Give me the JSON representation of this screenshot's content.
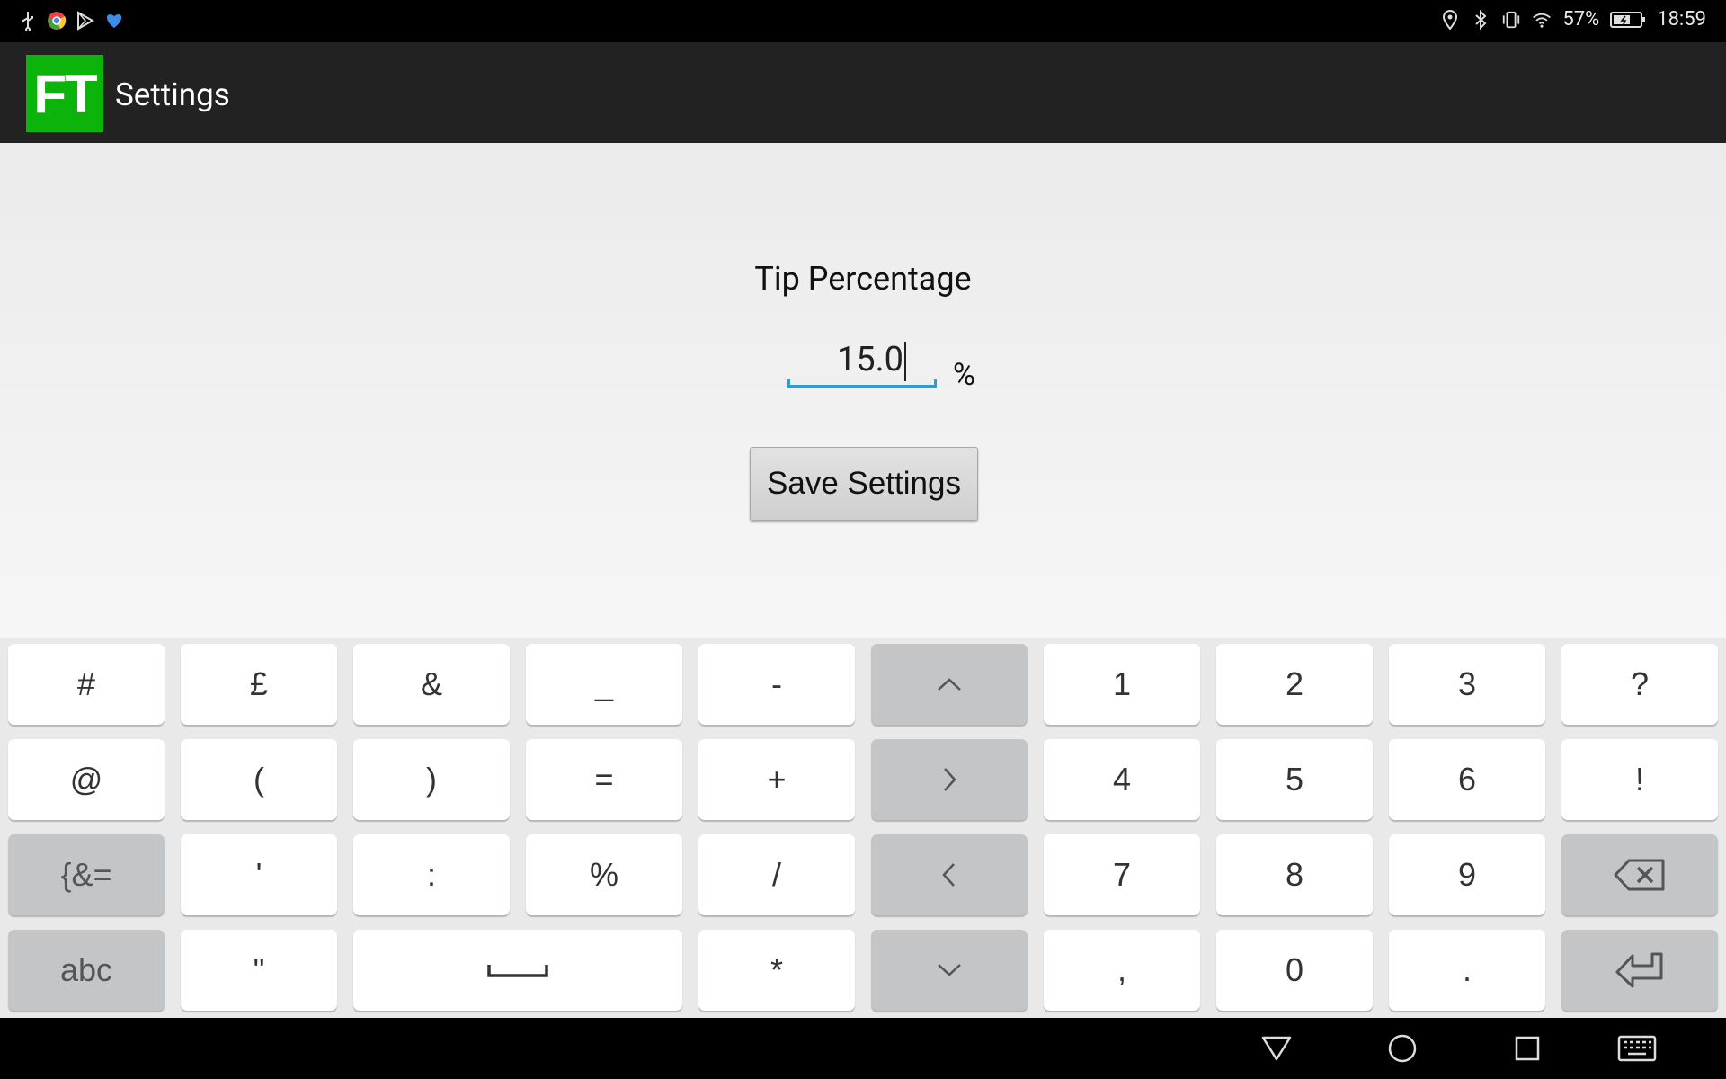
{
  "status_bar": {
    "battery_percent": "57%",
    "time": "18:59",
    "left_icons": [
      "usb-icon",
      "chrome-icon",
      "play-store-icon",
      "app-notification-icon"
    ],
    "right_icons": [
      "location-icon",
      "bluetooth-icon",
      "vibrate-icon",
      "wifi-icon",
      "battery-icon"
    ]
  },
  "app_bar": {
    "logo_text": "FT",
    "logo_color": "#0bb30b",
    "title": "Settings"
  },
  "settings": {
    "tip_label": "Tip Percentage",
    "tip_value": "15.0",
    "percent_sign": "%",
    "save_button": "Save Settings",
    "accent_color": "#2a9fd6"
  },
  "keyboard": {
    "rows": [
      [
        "#",
        "£",
        "&",
        "_",
        "-",
        "shift-up-icon",
        "1",
        "2",
        "3",
        "?"
      ],
      [
        "@",
        "(",
        ")",
        "=",
        "+",
        "cursor-right-icon",
        "4",
        "5",
        "6",
        "!"
      ],
      [
        "{&=",
        "'",
        ":",
        "%",
        "/",
        "cursor-left-icon",
        "7",
        "8",
        "9",
        "backspace-icon"
      ],
      [
        "abc",
        "\"",
        "space-icon",
        "*",
        "cursor-down-icon",
        ",",
        "0",
        ".",
        "enter-icon"
      ]
    ],
    "labels": {
      "r0": [
        "#",
        "£",
        "&",
        "_",
        "-",
        "",
        "1",
        "2",
        "3",
        "?"
      ],
      "r1": [
        "@",
        "(",
        ")",
        "=",
        "+",
        "",
        "4",
        "5",
        "6",
        "!"
      ],
      "r2": [
        "{&=",
        "'",
        ":",
        "%",
        "/",
        "",
        "7",
        "8",
        "9",
        ""
      ],
      "r3": [
        "abc",
        "\"",
        "",
        "*",
        "",
        ",",
        "0",
        ".",
        ""
      ]
    }
  },
  "nav_bar": {
    "buttons": [
      "back-icon",
      "home-icon",
      "recents-icon",
      "keyboard-switch-icon"
    ]
  }
}
